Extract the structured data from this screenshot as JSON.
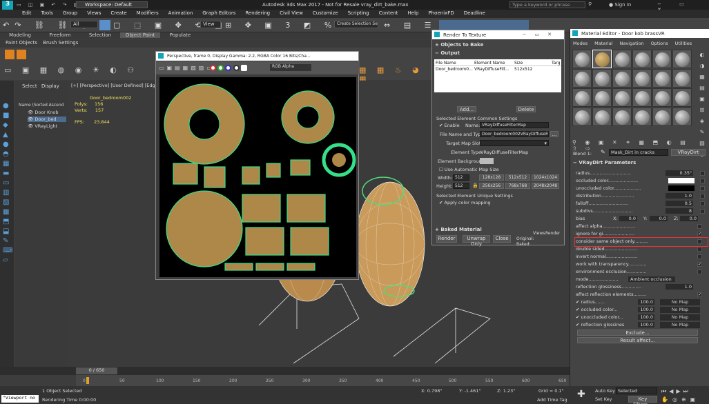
{
  "titlebar": {
    "workspace": "Workspace: Default",
    "app_title": "Autodesk 3ds Max 2017  -  Not for Resale    vray_dirt_bake.max",
    "search_placeholder": "Type a keyword or phrase",
    "sign_in": "Sign In"
  },
  "menu": [
    "Edit",
    "Tools",
    "Group",
    "Views",
    "Create",
    "Modifiers",
    "Animation",
    "Graph Editors",
    "Rendering",
    "Civil View",
    "Customize",
    "Scripting",
    "Content",
    "Help",
    "PhoenixFD",
    "Deadline"
  ],
  "toolbar": {
    "filter": "All",
    "view": "View",
    "selection_set": "Create Selection Se"
  },
  "ribbon": {
    "tabs": [
      "Modeling",
      "Freeform",
      "Selection",
      "Object Paint",
      "Populate"
    ],
    "active": "Object Paint",
    "sub": [
      "Paint Objects",
      "Brush Settings"
    ]
  },
  "scene_explorer": {
    "tabs": [
      "Select",
      "Display"
    ],
    "header": "Name (Sorted Ascend",
    "items": [
      "Door Knob",
      "Door_bed",
      "VRayLight"
    ]
  },
  "viewport": {
    "label": "[+] [Perspective] [User Defined] [Edged Fa",
    "object": "Door_bedroom002",
    "polys_label": "Polys:",
    "polys": "156",
    "verts_label": "Verts:",
    "verts": "157",
    "fps_label": "FPS:",
    "fps": "23.844"
  },
  "frame_window": {
    "title": "Perspective, frame 0, Display Gamma: 2.2, RGBA Color 16 Bits/Cha...",
    "channel": "RGB Alpha"
  },
  "rtt": {
    "title": "Render To Texture",
    "objects_to_bake": "Objects to Bake",
    "output": "Output",
    "columns": [
      "File Name",
      "Element Name",
      "Size",
      "Targ"
    ],
    "row": [
      "Door_bedroom0...",
      "VRayDiffuseFilt...",
      "512x512",
      ""
    ],
    "add": "Add...",
    "delete": "Delete",
    "common_settings": "Selected Element Common Settings",
    "enable": "Enable",
    "name_label": "Name:",
    "name_value": "VRayDiffuseFilterMap",
    "file_label": "File Name and Type:",
    "file_value": "Door_bedroom002VRayDiffuseFilte",
    "browse": "...",
    "target_label": "Target Map Slot:",
    "element_type_label": "Element Type:",
    "element_type_value": "VRayDiffuseFilterMap",
    "element_bg_label": "Element Background:",
    "auto_map_size": "Use Automatic Map Size",
    "width_label": "Width:",
    "width_value": "512",
    "height_label": "Height:",
    "height_value": "512",
    "sizes_row1": [
      "128x128",
      "512x512",
      "1024x1024"
    ],
    "sizes_row2": [
      "256x256",
      "768x768",
      "2048x2048"
    ],
    "unique_settings": "Selected Element Unique Settings",
    "apply_color_mapping": "Apply color mapping",
    "baked_material": "Baked Material",
    "render": "Render",
    "unwrap_only": "Unwrap Only",
    "close": "Close",
    "views": "Views",
    "render_col": "Render",
    "original": "Original:",
    "baked": "Baked:"
  },
  "material_editor": {
    "title": "Material Editor - Door kob brassVR",
    "menu": [
      "Modes",
      "Material",
      "Navigation",
      "Options",
      "Utilities"
    ],
    "slot_name": "Blend 1:",
    "map_name": "Mask_Dirt in cracks",
    "map_type": "VRayDirt",
    "rollout": "VRayDirt Parameters",
    "params": [
      {
        "label": "radius.............................",
        "value": "0.35\""
      },
      {
        "label": "occluded color.....................",
        "value": ""
      },
      {
        "label": "unoccluded color...................",
        "value": ""
      },
      {
        "label": "distribution.......................",
        "value": "1.0"
      },
      {
        "label": "falloff............................",
        "value": "0.5"
      },
      {
        "label": "subdivs............................",
        "value": "8"
      }
    ],
    "bias": {
      "label": "bias",
      "x_label": "X:",
      "x": "0.0",
      "y_label": "Y:",
      "y": "0.0",
      "z_label": "Z:",
      "z": "0.0"
    },
    "checks": [
      {
        "label": "affect alpha.......................",
        "checked": ""
      },
      {
        "label": "ignore for gi......................",
        "checked": "✓"
      },
      {
        "label": "consider same object only..........",
        "checked": ""
      },
      {
        "label": "double sided.......................",
        "checked": ""
      },
      {
        "label": "invert normal......................",
        "checked": ""
      },
      {
        "label": "work with transparency.............",
        "checked": "✓"
      },
      {
        "label": "environment occlusion..............",
        "checked": ""
      }
    ],
    "mode_label": "mode.....................",
    "mode_value": "Ambient occlusion",
    "reflection_glossiness": "reflection glossiness..............",
    "reflection_glossiness_value": "1.0",
    "affect_reflection": "affect reflection elements.........",
    "maps": [
      {
        "label": "radius.......",
        "amount": "100.0",
        "map": "No Map"
      },
      {
        "label": "occluded color...",
        "amount": "100.0",
        "map": "No Map"
      },
      {
        "label": "unoccluded color...",
        "amount": "100.0",
        "map": "No Map"
      },
      {
        "label": "reflection glossines",
        "amount": "100.0",
        "map": "No Map"
      }
    ],
    "exclude": "Exclude...",
    "result_affect": "Result affect..."
  },
  "timeline": {
    "frame": "0 / 650",
    "ticks": [
      "0",
      "50",
      "100",
      "150",
      "200",
      "250",
      "300",
      "350",
      "400",
      "450",
      "500",
      "550",
      "600",
      "650"
    ]
  },
  "status": {
    "script": "\"Viewport no",
    "selected": "1 Object Selected",
    "render_time": "Rendering Time  0:00:00",
    "x_label": "X:",
    "x": "0.798\"",
    "y_label": "Y:",
    "y": "-1.461\"",
    "z_label": "Z:",
    "z": "1.23\"",
    "grid": "Grid = 0.1\"",
    "add_time_tag": "Add Time Tag",
    "auto_key": "Auto Key",
    "set_key": "Set Key",
    "selected_dd": "Selected",
    "key_filters": "Key Filters..."
  }
}
